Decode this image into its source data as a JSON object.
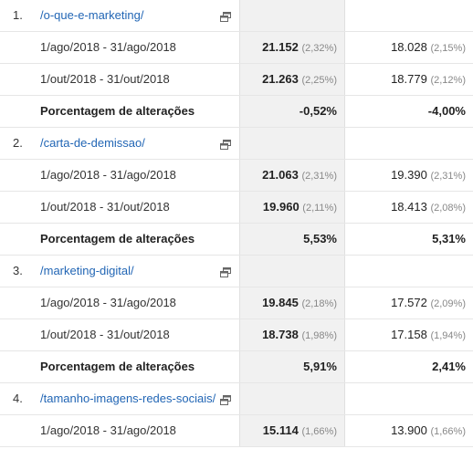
{
  "entries": [
    {
      "index": "1.",
      "path": "/o-que-e-marketing/",
      "rows": [
        {
          "period": "1/ago/2018 - 31/ago/2018",
          "m1": "21.152",
          "m1_pct": "(2,32%)",
          "m2": "18.028",
          "m2_pct": "(2,15%)"
        },
        {
          "period": "1/out/2018 - 31/out/2018",
          "m1": "21.263",
          "m1_pct": "(2,25%)",
          "m2": "18.779",
          "m2_pct": "(2,12%)"
        }
      ],
      "change": {
        "label": "Porcentagem de alterações",
        "m1": "-0,52%",
        "m2": "-4,00%"
      }
    },
    {
      "index": "2.",
      "path": "/carta-de-demissao/",
      "rows": [
        {
          "period": "1/ago/2018 - 31/ago/2018",
          "m1": "21.063",
          "m1_pct": "(2,31%)",
          "m2": "19.390",
          "m2_pct": "(2,31%)"
        },
        {
          "period": "1/out/2018 - 31/out/2018",
          "m1": "19.960",
          "m1_pct": "(2,11%)",
          "m2": "18.413",
          "m2_pct": "(2,08%)"
        }
      ],
      "change": {
        "label": "Porcentagem de alterações",
        "m1": "5,53%",
        "m2": "5,31%"
      }
    },
    {
      "index": "3.",
      "path": "/marketing-digital/",
      "rows": [
        {
          "period": "1/ago/2018 - 31/ago/2018",
          "m1": "19.845",
          "m1_pct": "(2,18%)",
          "m2": "17.572",
          "m2_pct": "(2,09%)"
        },
        {
          "period": "1/out/2018 - 31/out/2018",
          "m1": "18.738",
          "m1_pct": "(1,98%)",
          "m2": "17.158",
          "m2_pct": "(1,94%)"
        }
      ],
      "change": {
        "label": "Porcentagem de alterações",
        "m1": "5,91%",
        "m2": "2,41%"
      }
    },
    {
      "index": "4.",
      "path": "/tamanho-imagens-redes-sociais/",
      "rows": [
        {
          "period": "1/ago/2018 - 31/ago/2018",
          "m1": "15.114",
          "m1_pct": "(1,66%)",
          "m2": "13.900",
          "m2_pct": "(1,66%)"
        }
      ]
    }
  ],
  "icons": {
    "open_link": "open-in-new-window-icon"
  },
  "colors": {
    "link": "#2266b5",
    "highlight_column": "#f1f1f1",
    "percent_text": "#888888"
  }
}
